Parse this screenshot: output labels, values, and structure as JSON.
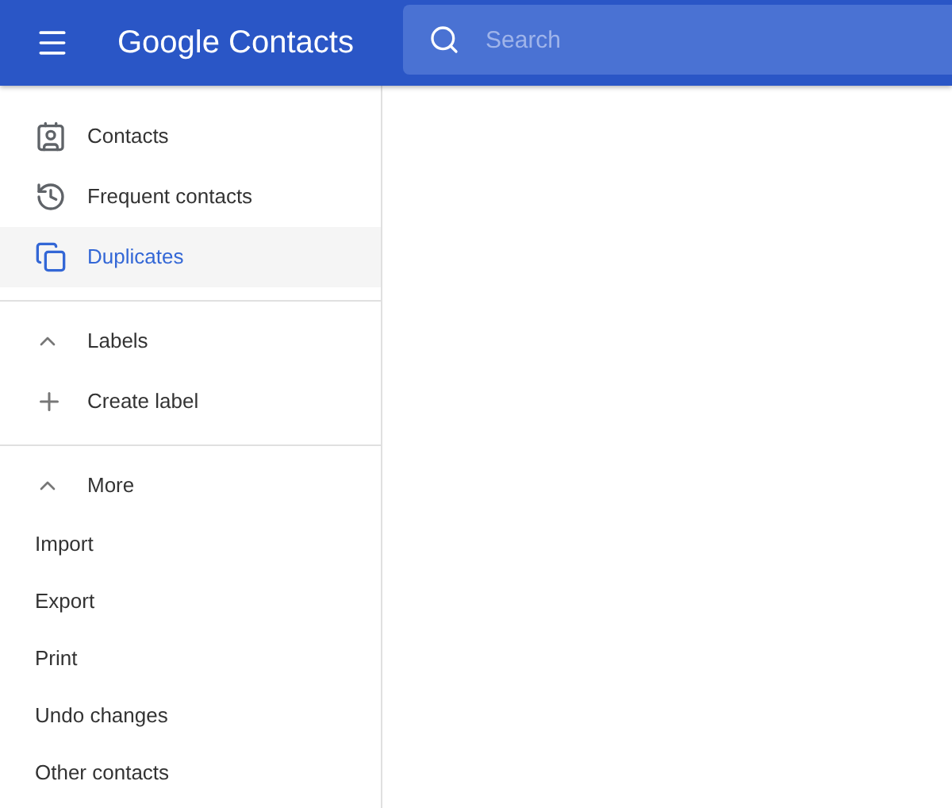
{
  "header": {
    "logo": "Google Contacts",
    "search": {
      "placeholder": "Search"
    }
  },
  "nav": [
    {
      "label": "Contacts",
      "kind": "contacts",
      "selected": false
    },
    {
      "label": "Frequent contacts",
      "kind": "history",
      "selected": false
    },
    {
      "label": "Duplicates",
      "kind": "duplicates",
      "selected": true
    }
  ],
  "labels": {
    "title": "Labels",
    "expanded": true,
    "items": [
      {
        "label": "Create label"
      }
    ]
  },
  "more": {
    "title": "More",
    "expanded": true,
    "items": [
      {
        "label": "Import"
      },
      {
        "label": "Export"
      },
      {
        "label": "Print"
      },
      {
        "label": "Undo changes"
      },
      {
        "label": "Other contacts"
      }
    ]
  }
}
